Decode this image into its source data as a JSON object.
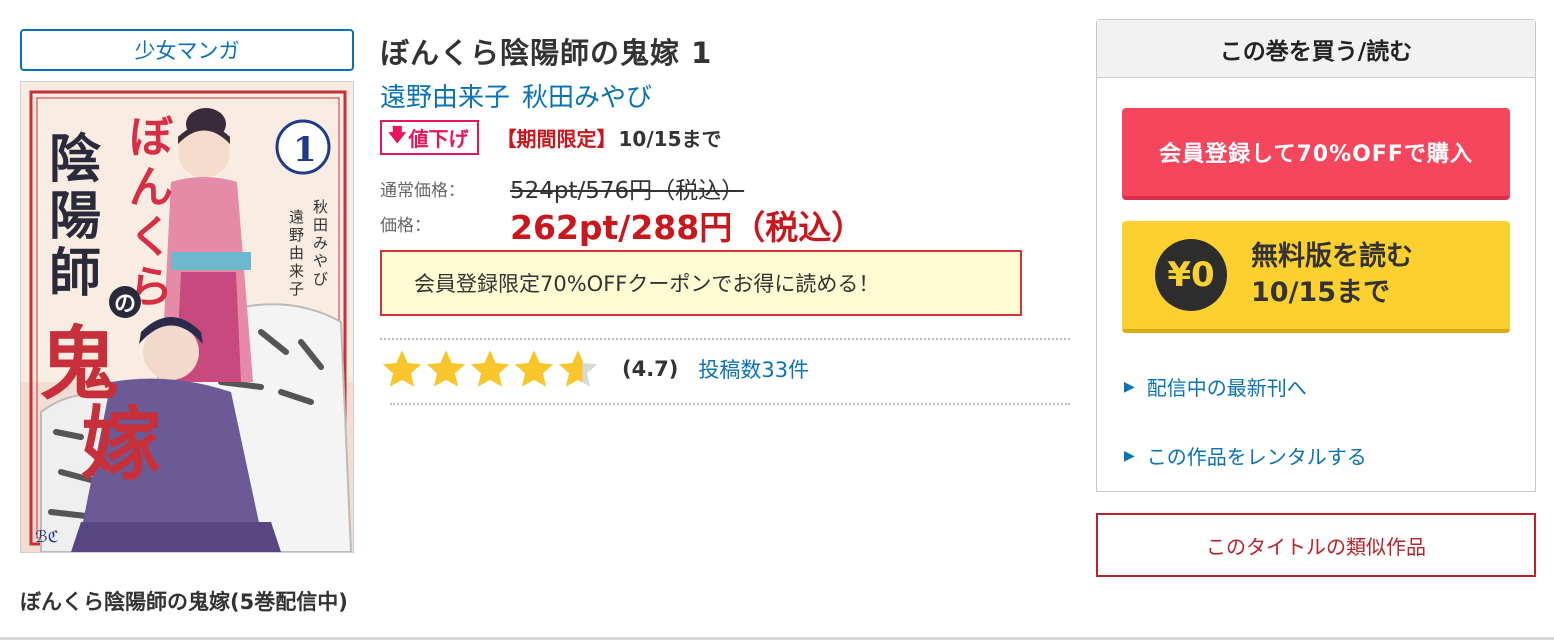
{
  "genre_tag": "少女マンガ",
  "cover": {
    "title_vertical": "ぼんくら陰陽師の鬼嫁",
    "volume_number": "1",
    "credit_original": "原作／秋田みやび",
    "credit_art": "漫画／遠野由来子"
  },
  "book": {
    "title": "ぼんくら陰陽師の鬼嫁 1",
    "authors": [
      "遠野由来子",
      "秋田みやび"
    ],
    "price_down_label": "値下げ",
    "limited_label": "【期間限定】",
    "limited_until": "10/15まで",
    "regular_price_label": "通常価格：",
    "regular_price": "524pt/576円（税込）",
    "price_label": "価格：",
    "sale_price": "262pt/288円（税込）",
    "coupon_text": "会員登録限定70%OFFクーポンでお得に読める！",
    "rating_value": 4.7,
    "rating_text": "(4.7)",
    "reviews_link": "投稿数33件"
  },
  "series_line": "ぼんくら陰陽師の鬼嫁(5巻配信中)",
  "buy_panel": {
    "header": "この巻を買う/読む",
    "register_button": "会員登録して70%OFFで購入",
    "free_icon": "¥0",
    "free_line1": "無料版を読む",
    "free_line2": "10/15まで",
    "link_latest": "配信中の最新刊へ",
    "link_rental": "この作品をレンタルする"
  },
  "similar_button": "このタイトルの類似作品",
  "colors": {
    "link_blue": "#0a73b6",
    "sale_red": "#c9171e",
    "register_pink": "#f5465e",
    "free_yellow": "#fcd12f",
    "star_gold": "#f8c62a"
  }
}
